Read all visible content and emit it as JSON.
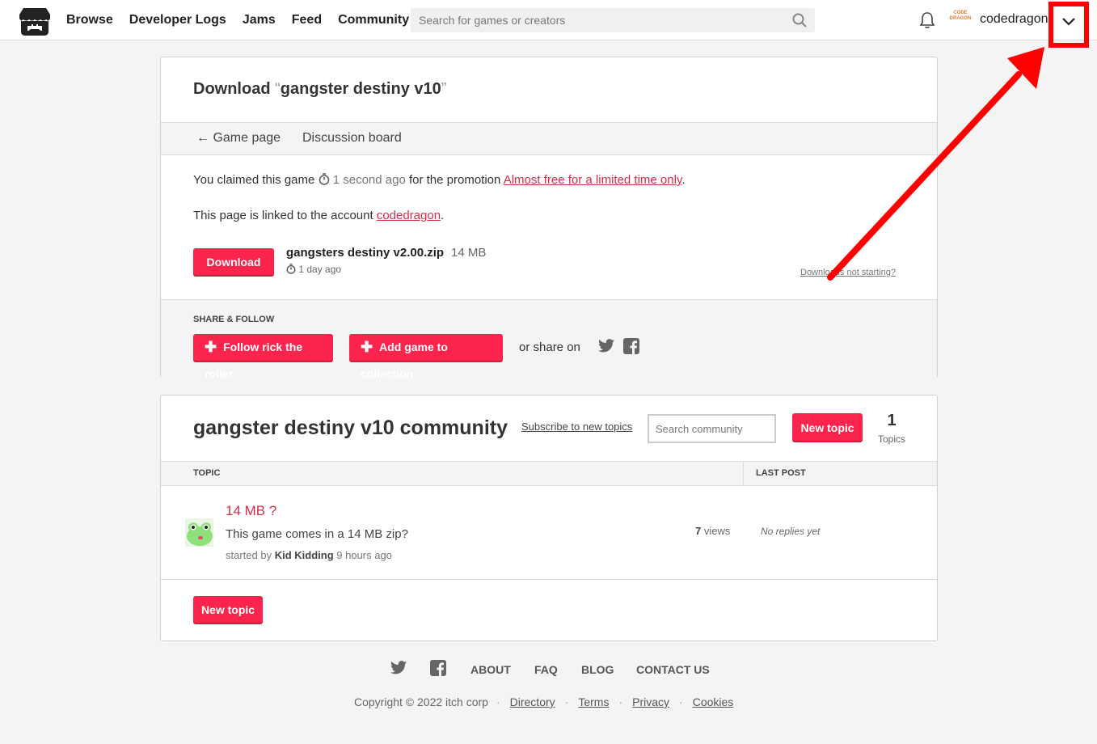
{
  "colors": {
    "accent": "#fa244c",
    "link": "#da2c49",
    "annotation": "#ff0000"
  },
  "header": {
    "nav": [
      "Browse",
      "Developer Logs",
      "Jams",
      "Feed",
      "Community"
    ],
    "search_placeholder": "Search for games or creators",
    "username": "codedragon",
    "avatar_text": "CODE DRAGON"
  },
  "download": {
    "title_prefix": "Download ",
    "title_open_quote": "“",
    "title_game": "gangster destiny v10",
    "title_close_quote": "”",
    "back_link": "Game page",
    "discussion_link": "Discussion board",
    "claim_text_1": "You claimed this game ",
    "claim_time": "1 second ago",
    "claim_text_2": " for the promotion ",
    "promo_link": "Almost free for a limited time only",
    "claim_end": ".",
    "linked_text": "This page is linked to the account ",
    "linked_account": "codedragon",
    "linked_end": ".",
    "download_button": "Download",
    "file_name": "gangsters destiny v2.00.zip",
    "file_size": "14 MB",
    "file_time": "1 day ago",
    "help_link": "Downloads not starting?"
  },
  "share": {
    "label": "SHARE & FOLLOW",
    "follow_button": "Follow rick the roller",
    "add_button": "Add game to collection",
    "share_on": "or share on"
  },
  "community": {
    "title": "gangster destiny v10 community",
    "subscribe": "Subscribe to new topics",
    "search_placeholder": "Search community",
    "new_topic": "New topic",
    "topic_count": "1",
    "topic_count_label": "Topics",
    "col_topic": "TOPIC",
    "col_last": "LAST POST",
    "topics": [
      {
        "title": "14 MB ?",
        "snippet": "This game comes in a 14 MB zip?",
        "started_by": "started by ",
        "author": "Kid Kidding",
        "ago": " 9 hours ago",
        "views_num": "7",
        "views_label": " views",
        "last_post": "No replies yet"
      }
    ],
    "new_topic_bottom": "New topic"
  },
  "footer": {
    "links": [
      "ABOUT",
      "FAQ",
      "BLOG",
      "CONTACT US"
    ],
    "copyright": "Copyright © 2022 itch corp",
    "legal": [
      "Directory",
      "Terms",
      "Privacy",
      "Cookies"
    ]
  }
}
